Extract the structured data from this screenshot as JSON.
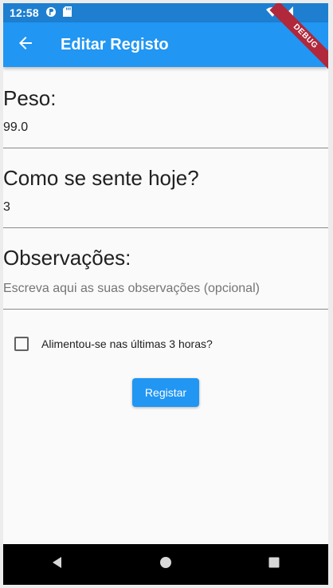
{
  "status_bar": {
    "time": "12:58"
  },
  "app_bar": {
    "title": "Editar Registo"
  },
  "debug_banner": {
    "label": "DEBUG"
  },
  "form": {
    "weight": {
      "label": "Peso:",
      "value": "99.0"
    },
    "mood": {
      "label": "Como se sente hoje?",
      "value": "3"
    },
    "notes": {
      "label": "Observações:",
      "placeholder": "Escreva aqui as suas observações (opcional)"
    },
    "ate_recently": {
      "label": "Alimentou-se nas últimas 3 horas?",
      "checked": false
    },
    "submit_label": "Registar"
  },
  "colors": {
    "primary": "#2196f3",
    "status_bar": "#1e7fd0",
    "debug_ribbon": "#b0283a",
    "nav_bar": "#000000"
  },
  "nav_icons": [
    "back-icon",
    "home-icon",
    "recents-icon"
  ]
}
